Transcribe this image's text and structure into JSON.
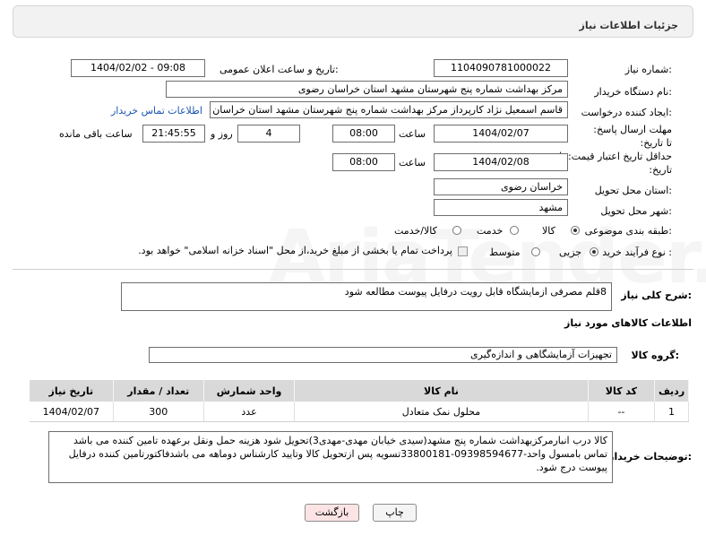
{
  "header": {
    "title": "جزئیات اطلاعات نیاز"
  },
  "fields": {
    "need_number_label": "شماره نیاز:",
    "need_number": "1104090781000022",
    "announce_label": "تاریخ و ساعت اعلان عمومی:",
    "announce_value": "1404/02/02 - 09:08",
    "buyer_org_label": "نام دستگاه خریدار:",
    "buyer_org": "مرکز بهداشت شماره پنج شهرستان مشهد استان خراسان رضوی",
    "creator_label": "ایجاد کننده درخواست:",
    "creator": "قاسم  اسمعیل نژاد کارپرداز مرکز بهداشت شماره پنج شهرستان مشهد استان خراسان رضوی",
    "buyer_contact_link": "اطلاعات تماس خریدار",
    "deadline_label": "مهلت ارسال پاسخ: تا تاریخ:",
    "deadline_date": "1404/02/07",
    "time_label": "ساعت",
    "deadline_time": "08:00",
    "days_value": "4",
    "days_label": "روز و",
    "remaining_time": "21:45:55",
    "remaining_label": "ساعت باقی مانده",
    "min_price_label": "حداقل تاریخ اعتبار قیمت: تا تاریخ:",
    "min_price_date": "1404/02/08",
    "min_price_time": "08:00",
    "province_label": "استان محل تحویل:",
    "province": "خراسان رضوی",
    "city_label": "شهر محل تحویل:",
    "city": "مشهد",
    "category_label": "طبقه بندی موضوعی:",
    "category_options": [
      "کالا",
      "خدمت",
      "کالا/خدمت"
    ],
    "category_selected": "کالا",
    "process_label": "نوع فرآیند خرید :",
    "process_options": [
      "جزیی",
      "متوسط"
    ],
    "process_selected": "جزیی",
    "payment_note": "پرداخت تمام یا بخشی از مبلغ خرید،از محل \"اسناد خزانه اسلامی\" خواهد بود."
  },
  "description": {
    "label": "شرح کلی نیاز:",
    "value": "8قلم مصرفی ازمایشگاه قابل رویت درفایل پیوست مطالعه شود"
  },
  "goods": {
    "section_title": "اطلاعات کالاهای مورد نیاز",
    "group_label": "گروه کالا:",
    "group_value": "تجهیزات آزمایشگاهی و اندازه‌گیری",
    "columns": [
      "ردیف",
      "کد کالا",
      "نام کالا",
      "واحد شمارش",
      "تعداد / مقدار",
      "تاریخ نیاز"
    ],
    "rows": [
      {
        "row": "1",
        "code": "--",
        "name": "محلول نمک متعادل",
        "unit": "عدد",
        "qty": "300",
        "date": "1404/02/07"
      }
    ]
  },
  "buyer_notes": {
    "label": "توضیحات خریدار:",
    "value": "کالا درب انبارمرکزبهداشت شماره پنج مشهد(سیدی خیابان مهدی-مهدی3)تحویل شود هزینه حمل ونقل برعهده تامین کننده می باشد  تماس بامسول واحد-09398594677-33800181تسویه پس ازتحویل کالا وتایید کارشناس دوماهه می باشدفاکتورتامین کننده درفایل پیوست درج شود."
  },
  "buttons": {
    "print": "چاپ",
    "back": "بازگشت"
  },
  "watermark": "AriaTender.net",
  "colors": {
    "link": "#1a56b3",
    "table_header": "#d9d9d9",
    "back_button_bg": "#fde4e4"
  }
}
